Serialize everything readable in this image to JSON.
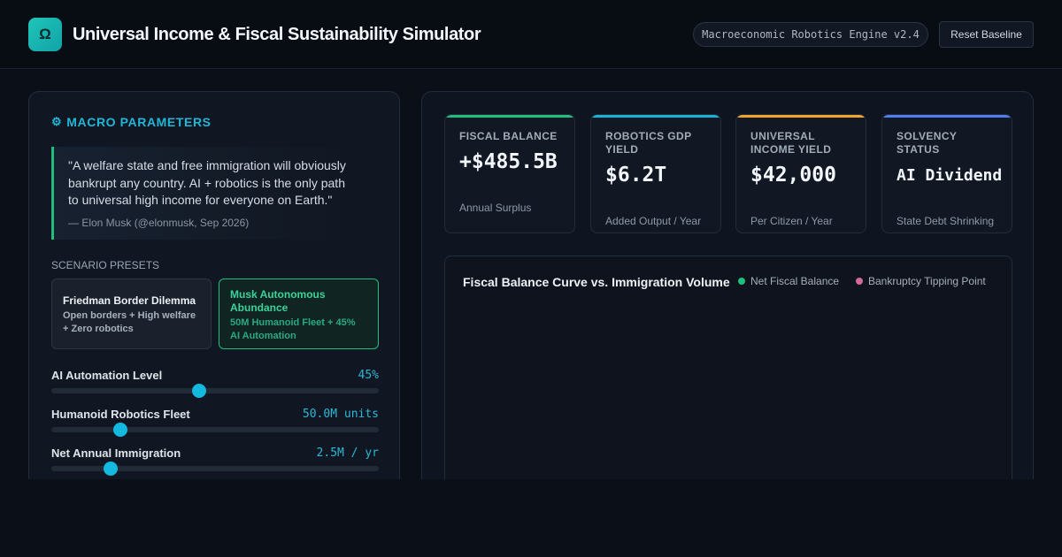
{
  "header": {
    "logo_glyph": "Ω",
    "title": "Universal Income & Fiscal Sustainability Simulator",
    "engine_badge": "Macroeconomic Robotics Engine v2.4",
    "reset_label": "Reset Baseline"
  },
  "params": {
    "section_icon": "⚙",
    "section_title": "MACRO PARAMETERS",
    "quote_text": "\"A welfare state and free immigration will obviously bankrupt any country. AI + robotics is the only path to universal high income for everyone on Earth.\"",
    "quote_attribution": "— Elon Musk (@elonmusk, Sep 2026)",
    "presets_label": "SCENARIO PRESETS",
    "presets": [
      {
        "title": "Friedman Border Dilemma",
        "subtitle": "Open borders + High welfare + Zero robotics"
      },
      {
        "title": "Musk Autonomous Abundance",
        "subtitle": "50M Humanoid Fleet + 45% AI Automation"
      }
    ],
    "sliders": [
      {
        "label": "AI Automation Level",
        "value": "45%",
        "fraction": 0.45
      },
      {
        "label": "Humanoid Robotics Fleet",
        "value": "50.0M units",
        "fraction": 0.21
      },
      {
        "label": "Net Annual Immigration",
        "value": "2.5M / yr",
        "fraction": 0.18
      }
    ]
  },
  "stats": [
    {
      "label": "FISCAL BALANCE",
      "value": "+$485.5B",
      "sub": "Annual Surplus",
      "color": "#1fbf7d"
    },
    {
      "label": "ROBOTICS GDP YIELD",
      "value": "$6.2T",
      "sub": "Added Output / Year",
      "color": "#18b4d8"
    },
    {
      "label": "UNIVERSAL INCOME YIELD",
      "value": "$42,000",
      "sub": "Per Citizen / Year",
      "color": "#f0a52a"
    },
    {
      "label": "SOLVENCY STATUS",
      "value": "AI Dividend S",
      "sub": "State Debt Shrinking",
      "color": "#4f7ef0"
    }
  ],
  "chart": {
    "title": "Fiscal Balance Curve vs. Immigration Volume",
    "legend": [
      {
        "label": "Net Fiscal Balance",
        "color": "#1fbf7d"
      },
      {
        "label": "Bankruptcy Tipping Point",
        "color": "#d56a9a"
      }
    ]
  }
}
